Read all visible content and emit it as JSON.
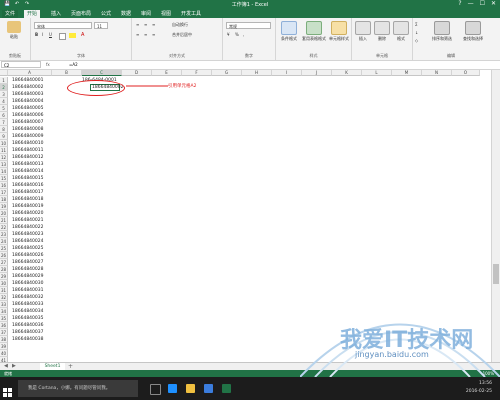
{
  "window": {
    "title": "工作簿1 - Excel",
    "controls": [
      "?",
      "—",
      "☐",
      "✕"
    ]
  },
  "qat": {
    "save": "💾",
    "undo": "↶",
    "redo": "↷"
  },
  "tabs": [
    "文件",
    "开始",
    "插入",
    "页面布局",
    "公式",
    "数据",
    "审阅",
    "视图",
    "开发工具"
  ],
  "ribbon": {
    "clipboard": {
      "paste": "粘贴",
      "label": "剪贴板"
    },
    "font": {
      "name": "宋体",
      "size": "11",
      "bold": "B",
      "italic": "I",
      "underline": "U",
      "label": "字体"
    },
    "alignment": {
      "wrap": "自动换行",
      "merge": "合并后居中",
      "label": "对齐方式"
    },
    "number": {
      "format": "常规",
      "label": "数字"
    },
    "styles": {
      "conditional": "条件格式",
      "table": "套用表格格式",
      "cell": "单元格样式",
      "label": "样式"
    },
    "cells": {
      "insert": "插入",
      "delete": "删除",
      "format": "格式",
      "label": "单元格"
    },
    "editing": {
      "sort": "排序和筛选",
      "find": "查找和选择",
      "label": "编辑"
    }
  },
  "formula_bar": {
    "name_box": "C2",
    "fx": "fx",
    "formula": "=A2"
  },
  "columns": [
    "A",
    "B",
    "C",
    "D",
    "E",
    "F",
    "G",
    "H",
    "I",
    "J",
    "K",
    "L",
    "M",
    "N",
    "O"
  ],
  "selected_column": "C",
  "rows": [
    "1",
    "2",
    "3",
    "4",
    "5",
    "6",
    "7",
    "8",
    "9",
    "10",
    "11",
    "12",
    "13",
    "14",
    "15",
    "16",
    "17",
    "18",
    "19",
    "20",
    "21",
    "22",
    "23",
    "24",
    "25",
    "26",
    "27",
    "28",
    "29",
    "30",
    "31",
    "32",
    "33",
    "34",
    "35",
    "36",
    "37",
    "38",
    "39",
    "40",
    "41"
  ],
  "selected_row": "2",
  "column_a": [
    "18664840001",
    "18664840002",
    "18664840003",
    "18664840004",
    "18664840005",
    "18664840006",
    "18664840007",
    "18664840008",
    "18664840009",
    "18664840010",
    "18664840011",
    "18664840012",
    "18664840013",
    "18664840014",
    "18664840015",
    "18664840016",
    "18664840017",
    "18664840018",
    "18664840019",
    "18664840020",
    "18664840021",
    "18664840022",
    "18664840023",
    "18664840024",
    "18664840025",
    "18664840026",
    "18664840027",
    "18664840028",
    "18664840029",
    "18664840030",
    "18664840031",
    "18664840032",
    "18664840033",
    "18664840034",
    "18664840035",
    "18664840036",
    "18664840037",
    "18664840038"
  ],
  "c1": "186-6484-0001",
  "c2": "18664840002",
  "annotation": "引用单元格A2",
  "sheet_tabs": {
    "active": "Sheet1",
    "add": "+"
  },
  "status": {
    "ready": "就绪",
    "zoom": "100%"
  },
  "taskbar": {
    "search_placeholder": "我是 Cortana，小娜。有问题尽管问我。",
    "time": "13:56",
    "date": "2016-02-25"
  },
  "watermark": {
    "text": "我爱IT技术网",
    "url": "jingyan.baidu.com"
  },
  "colors": {
    "excel_green": "#217346",
    "annotation_red": "#e02020",
    "taskbar": "#1c1c1c"
  }
}
